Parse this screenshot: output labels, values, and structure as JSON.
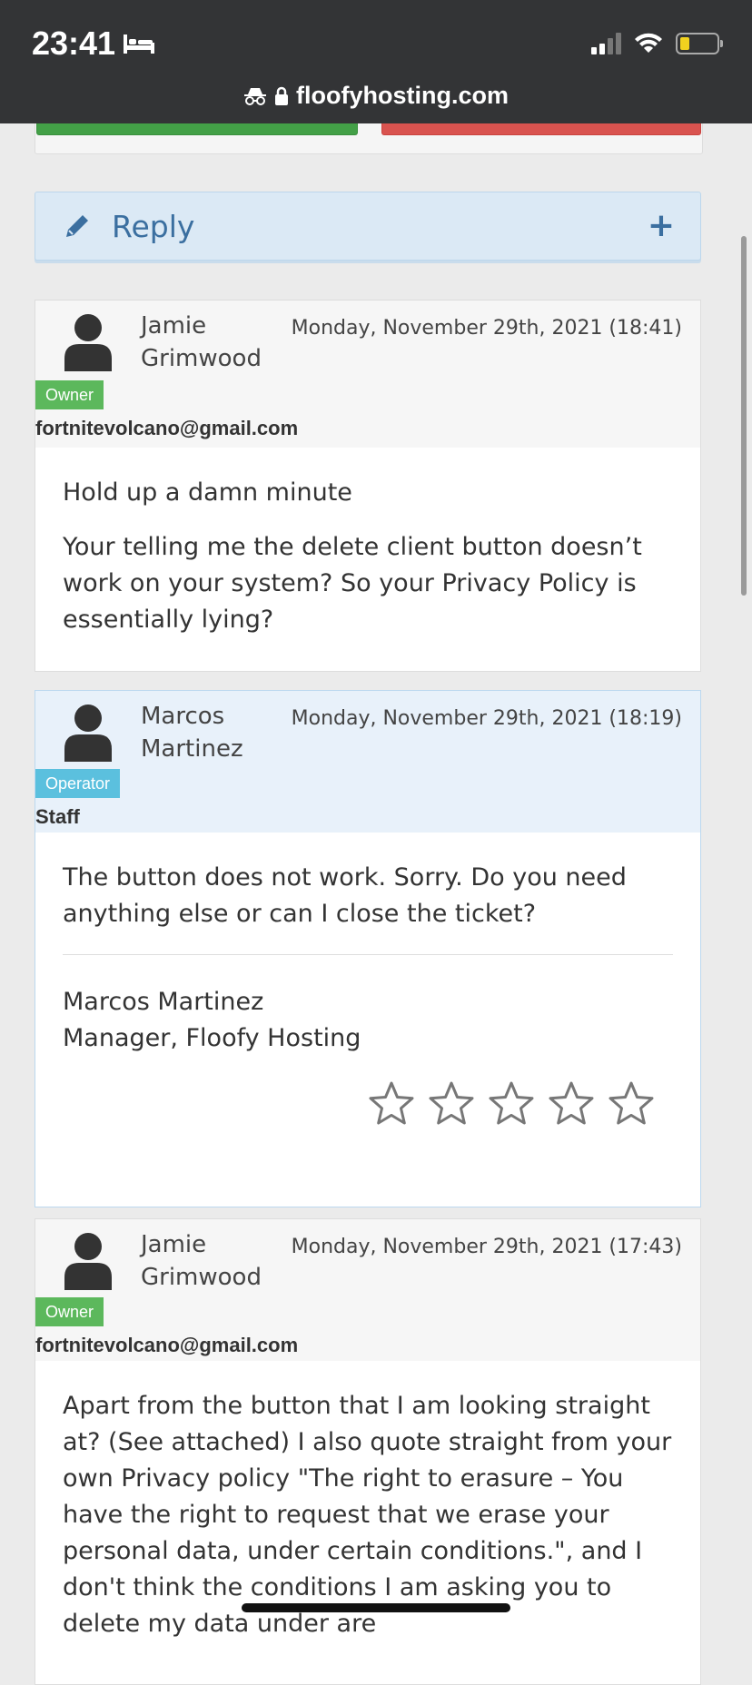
{
  "status_bar": {
    "time": "23:41"
  },
  "address_bar": {
    "url": "floofyhosting.com"
  },
  "reply_panel": {
    "label": "Reply",
    "toggle": "+"
  },
  "messages": [
    {
      "name": "Jamie Grimwood",
      "date": "Monday, November 29th, 2021 (18:41)",
      "badge": "Owner",
      "requestor": "fortnitevolcano@gmail.com",
      "paragraphs": [
        "Hold up a damn minute",
        "Your telling me the delete client button doesn’t work on your system? So your Privacy Policy is essentially lying?"
      ]
    },
    {
      "name": "Marcos Martinez",
      "date": "Monday, November 29th, 2021 (18:19)",
      "badge": "Operator",
      "requestor": "Staff",
      "paragraphs": [
        "The button does not work. Sorry. Do you need anything else or can I close the ticket?"
      ],
      "signature_name": "Marcos Martinez",
      "signature_title": "Manager, Floofy Hosting",
      "rating_stars": 5
    },
    {
      "name": "Jamie Grimwood",
      "date": "Monday, November 29th, 2021 (17:43)",
      "badge": "Owner",
      "requestor": "fortnitevolcano@gmail.com",
      "paragraphs": [
        "Apart from the button that I am looking straight at? (See attached) I also quote straight from your own Privacy policy \"The right to erasure – You have the right to request that we erase your personal data, under certain conditions.\", and I don't think the conditions I am asking you to delete my data under are"
      ]
    }
  ]
}
